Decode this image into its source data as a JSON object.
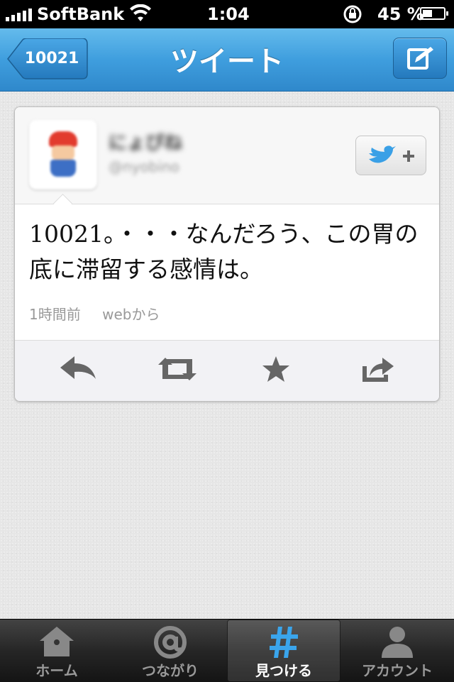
{
  "status_bar": {
    "carrier": "SoftBank",
    "time": "1:04",
    "battery_percent": "45 %",
    "battery_level": 0.45
  },
  "nav": {
    "title": "ツイート",
    "back_label": "10021"
  },
  "tweet": {
    "user_name": "にょぴね",
    "user_handle": "@nyobino",
    "text": "10021。・・・なんだろう、この胃の底に滞留する感情は。",
    "time_ago": "1時間前",
    "source": "webから"
  },
  "tabs": [
    {
      "label": "ホーム",
      "icon": "home-icon"
    },
    {
      "label": "つながり",
      "icon": "at-icon"
    },
    {
      "label": "見つける",
      "icon": "hash-icon",
      "active": true
    },
    {
      "label": "アカウント",
      "icon": "person-icon"
    }
  ],
  "colors": {
    "nav_blue": "#3f9ede",
    "tab_active_blue": "#3aa5ec"
  }
}
